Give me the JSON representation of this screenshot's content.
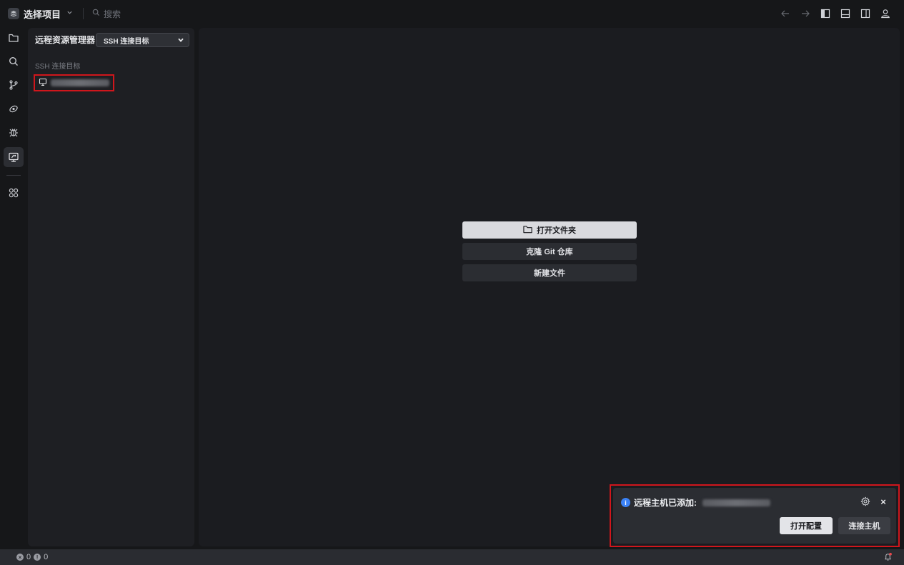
{
  "titlebar": {
    "project_label": "选择项目",
    "search_placeholder": "搜索",
    "icons": [
      "nav-back-icon",
      "nav-forward-icon",
      "toggle-primary-sidebar-icon",
      "toggle-panel-icon",
      "toggle-secondary-sidebar-icon",
      "account-icon"
    ]
  },
  "activity_bar": {
    "items": [
      "explorer-icon",
      "search-icon",
      "source-control-icon",
      "run-icon",
      "debug-icon",
      "remote-explorer-icon",
      "extensions-icon"
    ],
    "active": "remote-explorer-icon"
  },
  "sidebar": {
    "title": "远程资源管理器",
    "target_select": "SSH 连接目标",
    "section_label": "SSH 连接目标",
    "host_icon": "monitor-icon"
  },
  "editor": {
    "open_folder": "打开文件夹",
    "clone_repo": "克隆 Git 仓库",
    "new_file": "新建文件"
  },
  "notification": {
    "message": "远程主机已添加:",
    "open_config": "打开配置",
    "connect_host": "连接主机",
    "close_glyph": "×"
  },
  "status_bar": {
    "errors": "0",
    "warnings": "0"
  },
  "colors": {
    "background": "#161719",
    "sidebar": "#1e1f23",
    "editor": "#1b1c20",
    "highlight_border": "#d0161c",
    "info_accent": "#3b82f6"
  }
}
